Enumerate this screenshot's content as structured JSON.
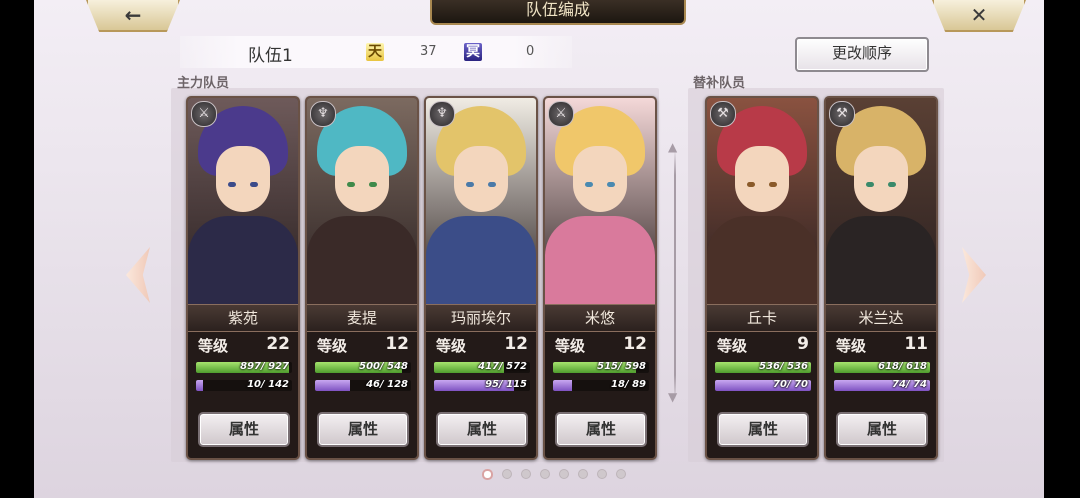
{
  "header": {
    "title": "队伍编成",
    "back_icon": "←",
    "close_icon": "✕"
  },
  "team": {
    "name": "队伍1",
    "cost_a_icon": "天",
    "cost_a_value": "37",
    "cost_b_icon": "冥",
    "cost_b_value": "0",
    "order_button": "更改顺序"
  },
  "sections": {
    "main": "主力队员",
    "sub": "替补队员"
  },
  "level_label": "等级",
  "attr_label": "属性",
  "main_members": [
    {
      "name": "紫苑",
      "level": "22",
      "hp": "897/ 927",
      "hp_pct": 97,
      "exp": "10/ 142",
      "exp_pct": 7,
      "class_icon": "sword-icon",
      "class_glyph": "⚔"
    },
    {
      "name": "麦提",
      "level": "12",
      "hp": "500/ 548",
      "hp_pct": 91,
      "exp": "46/ 128",
      "exp_pct": 36,
      "class_icon": "staff-icon",
      "class_glyph": "♆"
    },
    {
      "name": "玛丽埃尔",
      "level": "12",
      "hp": "417/ 572",
      "hp_pct": 73,
      "exp": "95/ 115",
      "exp_pct": 83,
      "class_icon": "staff-icon",
      "class_glyph": "♆"
    },
    {
      "name": "米悠",
      "level": "12",
      "hp": "515/ 598",
      "hp_pct": 86,
      "exp": "18/ 89",
      "exp_pct": 20,
      "class_icon": "sword-icon",
      "class_glyph": "⚔"
    }
  ],
  "sub_members": [
    {
      "name": "丘卡",
      "level": "9",
      "hp": "536/ 536",
      "hp_pct": 100,
      "exp": "70/ 70",
      "exp_pct": 100,
      "class_icon": "axe-icon",
      "class_glyph": "⚒"
    },
    {
      "name": "米兰达",
      "level": "11",
      "hp": "618/ 618",
      "hp_pct": 100,
      "exp": "74/ 74",
      "exp_pct": 100,
      "class_icon": "axe-icon",
      "class_glyph": "⚒"
    }
  ],
  "pager": {
    "count": 8,
    "current": 1
  },
  "colors": {
    "hp_bar": "#6fc044",
    "exp_bar": "#9b6fd8",
    "card_bg": "#231a18"
  }
}
